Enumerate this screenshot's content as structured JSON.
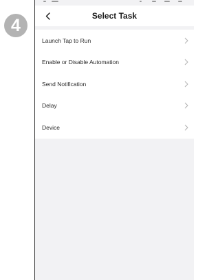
{
  "step_badge": "4",
  "nav": {
    "back_icon": "chevron-left-icon",
    "title": "Select Task"
  },
  "tasks": [
    {
      "label": "Launch Tap to Run",
      "icon": "chevron-right-icon"
    },
    {
      "label": "Enable or Disable Automation",
      "icon": "chevron-right-icon"
    },
    {
      "label": "Send Notification",
      "icon": "chevron-right-icon"
    },
    {
      "label": "Delay",
      "icon": "chevron-right-icon"
    },
    {
      "label": "Device",
      "icon": "chevron-right-icon"
    }
  ],
  "colors": {
    "badge": "#b3b3b3",
    "screen_background": "#f2f2f4",
    "list_background": "#ffffff",
    "chevron": "#b0b0b0"
  }
}
